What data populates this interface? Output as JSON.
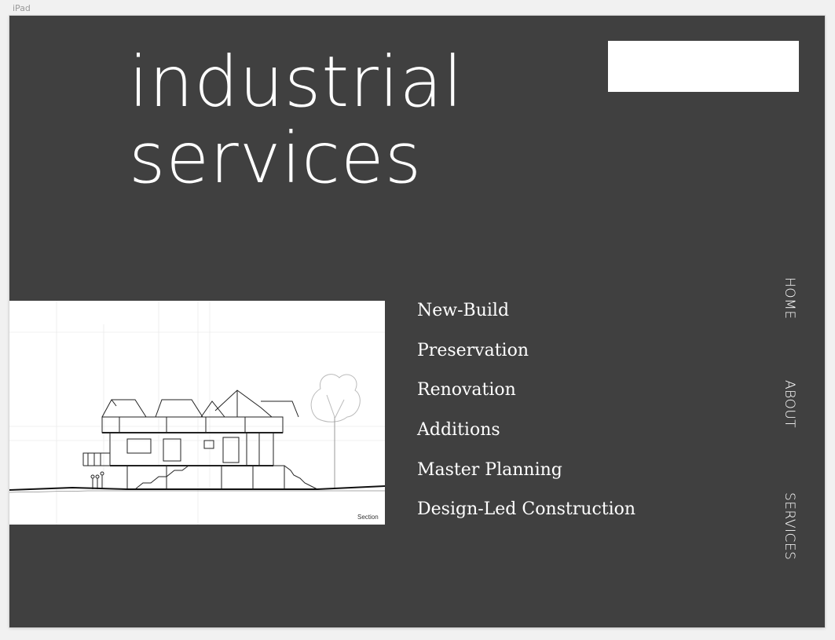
{
  "artboard": {
    "label": "iPad",
    "background": "#404040"
  },
  "hero": {
    "line1": "industrial",
    "line2": "services"
  },
  "logo": {
    "placeholder_color": "#ffffff"
  },
  "drawing": {
    "caption": "Section"
  },
  "services": [
    "New-Build",
    "Preservation",
    "Renovation",
    "Additions",
    "Master Planning",
    "Design-Led Construction"
  ],
  "nav": {
    "home": "HOME",
    "about": "ABOUT",
    "services": "SERVICES"
  }
}
